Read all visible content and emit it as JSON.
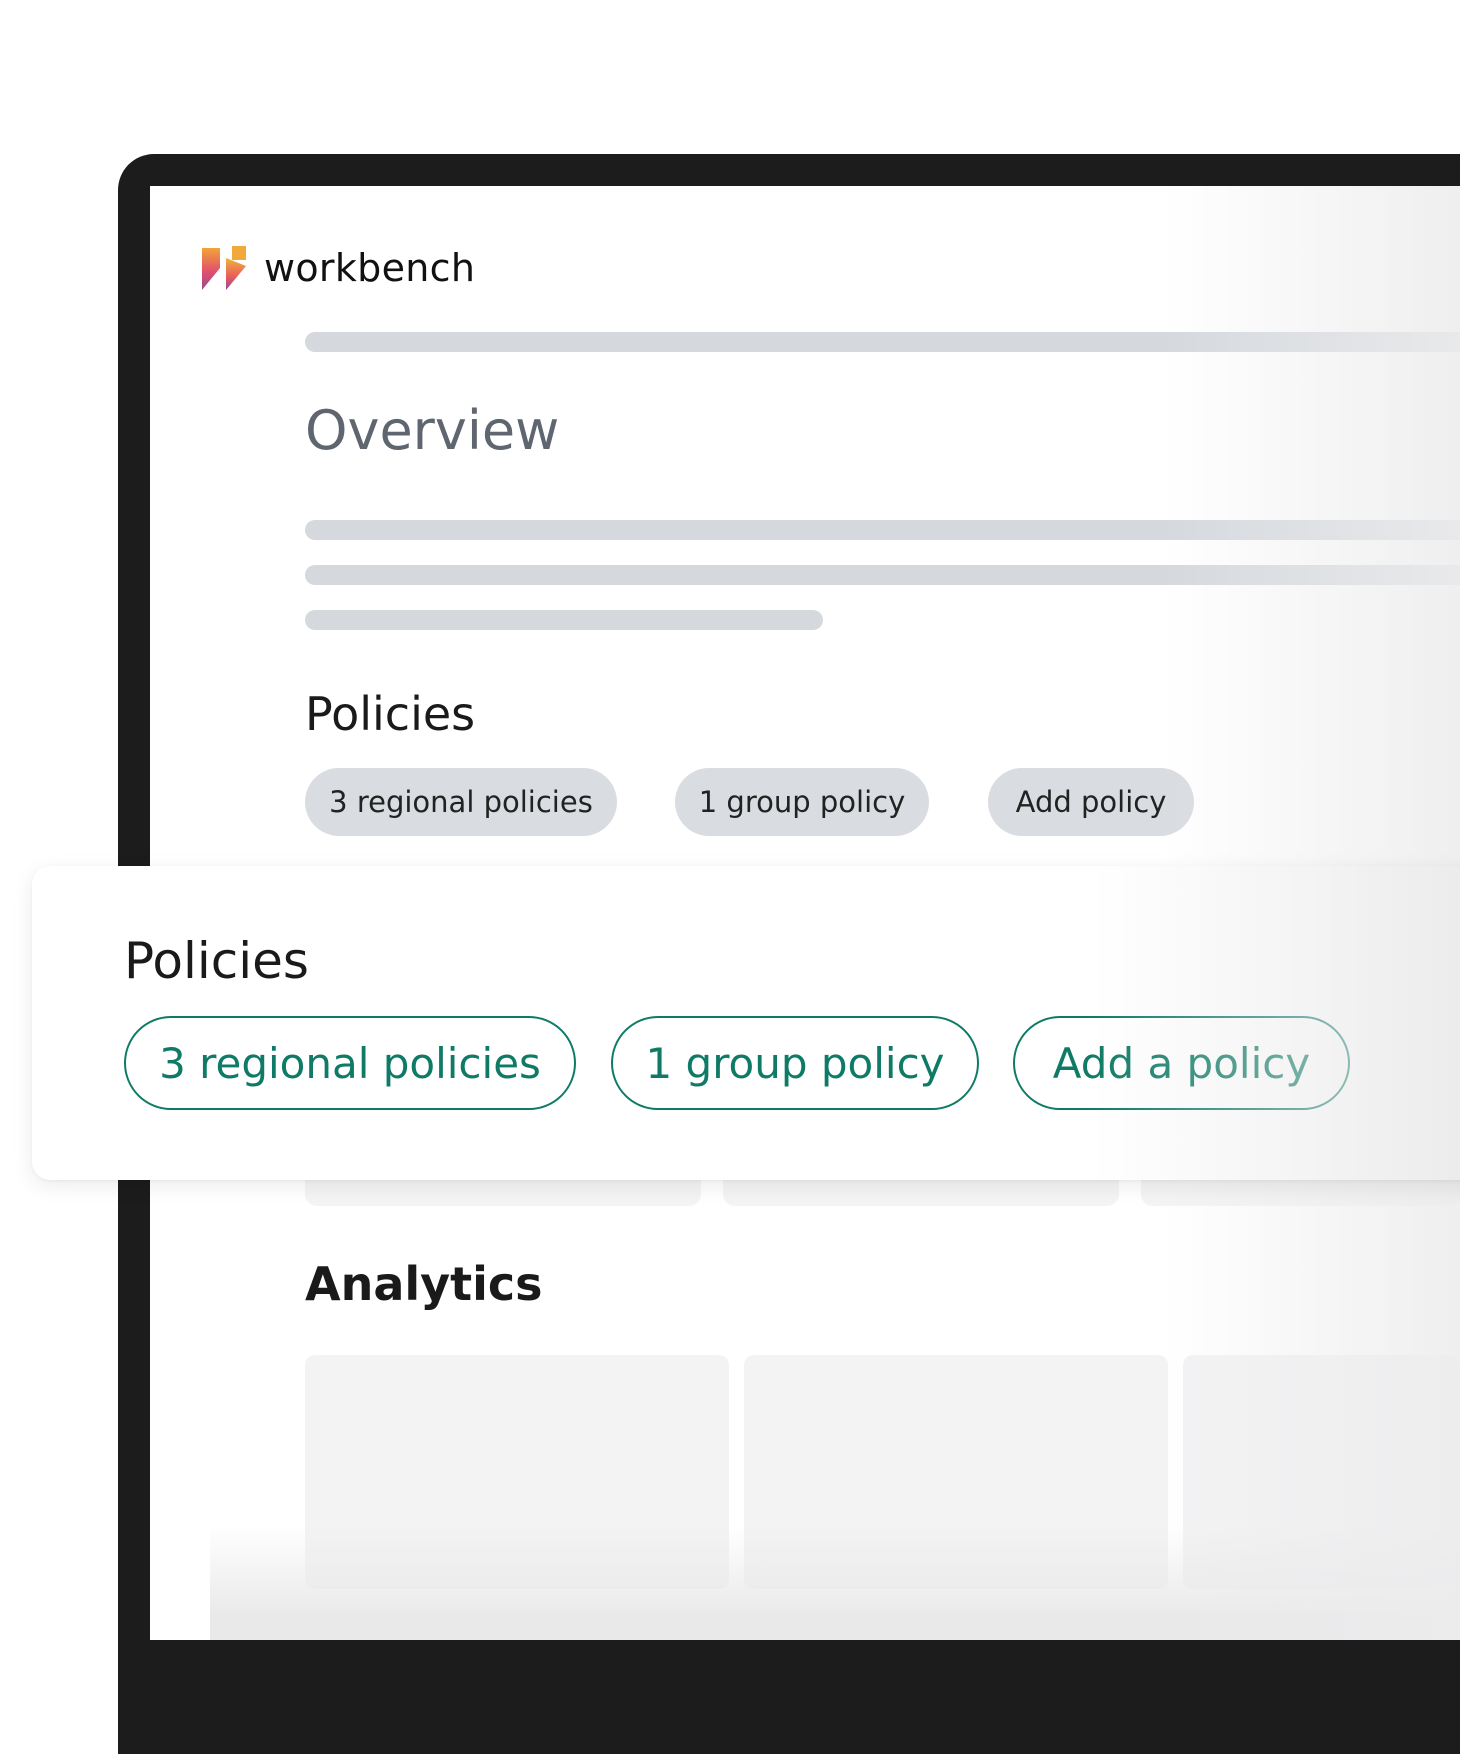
{
  "app": {
    "name": "workbench",
    "logo_icon": "workbench-logo-icon",
    "logo_colors": [
      "#f2a437",
      "#e2506b",
      "#8a4b9c"
    ]
  },
  "main": {
    "overview_title": "Overview",
    "policies_title": "Policies",
    "policy_chips": [
      {
        "label": "3 regional policies"
      },
      {
        "label": "1 group policy"
      },
      {
        "label": "Add policy"
      }
    ],
    "analytics_title": "Analytics"
  },
  "policies_panel": {
    "title": "Policies",
    "chips": [
      {
        "label": "3 regional policies"
      },
      {
        "label": "1 group policy"
      },
      {
        "label": "Add a policy"
      }
    ],
    "accent_color": "#0f7b66"
  }
}
